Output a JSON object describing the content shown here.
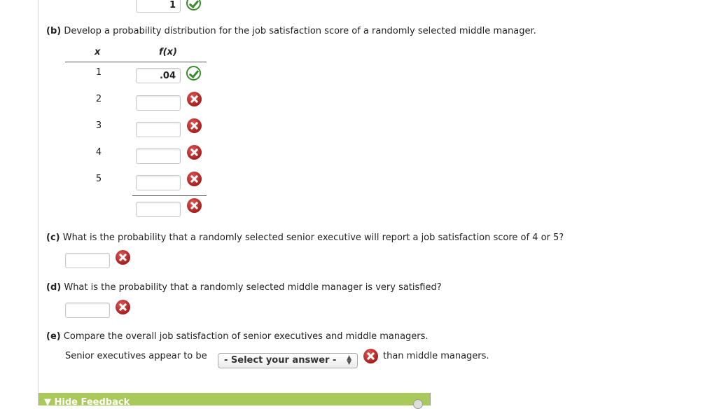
{
  "top_answer": {
    "value": "1",
    "status": "correct"
  },
  "part_b": {
    "label": "(b)",
    "question": "Develop a probability distribution for the job satisfaction score of a randomly selected middle manager.",
    "col_x": "x",
    "col_fx": "f(x)",
    "rows": [
      {
        "x": "1",
        "value": ".04",
        "status": "correct"
      },
      {
        "x": "2",
        "value": "",
        "status": "incorrect"
      },
      {
        "x": "3",
        "value": "",
        "status": "incorrect"
      },
      {
        "x": "4",
        "value": "",
        "status": "incorrect"
      },
      {
        "x": "5",
        "value": "",
        "status": "incorrect"
      }
    ],
    "total": {
      "value": "",
      "status": "incorrect"
    }
  },
  "part_c": {
    "label": "(c)",
    "question": "What is the probability that a randomly selected senior executive will report a job satisfaction score of 4 or 5?",
    "answer": "",
    "status": "incorrect"
  },
  "part_d": {
    "label": "(d)",
    "question": "What is the probability that a randomly selected middle manager is very satisfied?",
    "answer": "",
    "status": "incorrect"
  },
  "part_e": {
    "label": "(e)",
    "question": "Compare the overall job satisfaction of senior executives and middle managers.",
    "prefix": "Senior executives appear to be",
    "select_value": "- Select your answer -",
    "suffix": "than middle managers.",
    "status": "incorrect"
  },
  "feedback": {
    "toggle_label": "Hide Feedback",
    "arrow": "▼"
  }
}
